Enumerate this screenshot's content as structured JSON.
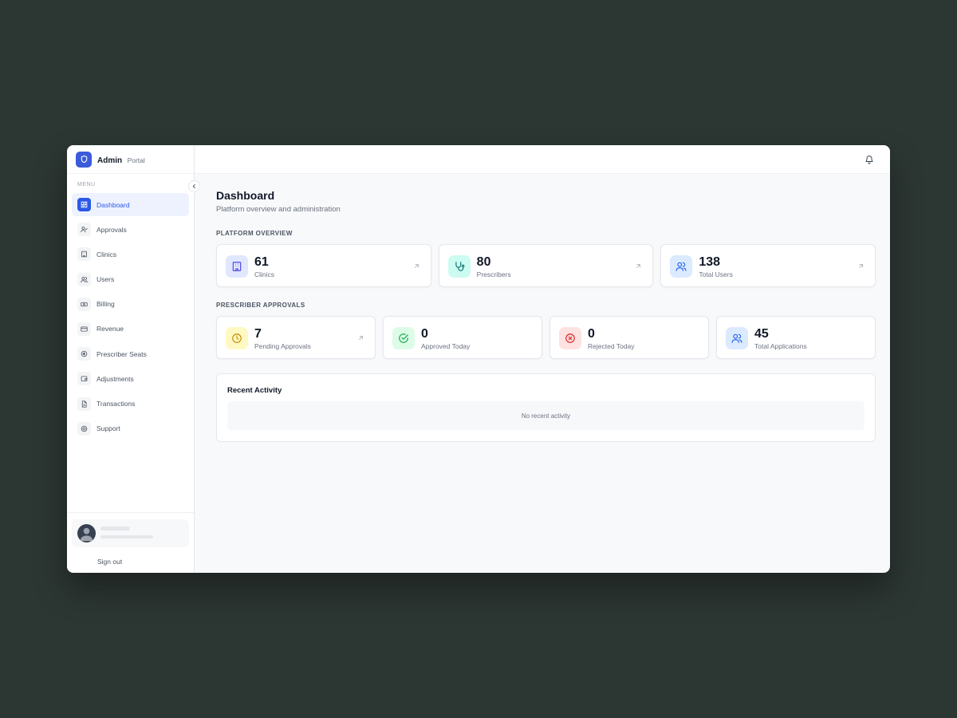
{
  "brand": {
    "title": "Admin",
    "subtitle": "Portal"
  },
  "sidebar": {
    "menu_label": "MENU",
    "items": [
      {
        "label": "Dashboard",
        "icon": "dashboard-icon",
        "active": true
      },
      {
        "label": "Approvals",
        "icon": "user-check-icon"
      },
      {
        "label": "Clinics",
        "icon": "building-icon"
      },
      {
        "label": "Users",
        "icon": "users-icon"
      },
      {
        "label": "Billing",
        "icon": "banknote-icon"
      },
      {
        "label": "Revenue",
        "icon": "credit-card-icon"
      },
      {
        "label": "Prescriber Seats",
        "icon": "currency-icon"
      },
      {
        "label": "Adjustments",
        "icon": "wallet-icon"
      },
      {
        "label": "Transactions",
        "icon": "file-text-icon"
      },
      {
        "label": "Support",
        "icon": "lifebuoy-icon"
      }
    ],
    "sign_out": "Sign out"
  },
  "page": {
    "title": "Dashboard",
    "subtitle": "Platform overview and administration"
  },
  "platform_overview": {
    "label": "PLATFORM OVERVIEW",
    "cards": [
      {
        "value": "61",
        "label": "Clinics",
        "icon": "building-icon",
        "color": "#4f46e5",
        "bg": "#e0e7ff"
      },
      {
        "value": "80",
        "label": "Prescribers",
        "icon": "stethoscope-icon",
        "color": "#0f766e",
        "bg": "#ccfbf1"
      },
      {
        "value": "138",
        "label": "Total Users",
        "icon": "users-icon",
        "color": "#2563eb",
        "bg": "#dbeafe"
      }
    ]
  },
  "prescriber_approvals": {
    "label": "PRESCRIBER APPROVALS",
    "cards": [
      {
        "value": "7",
        "label": "Pending Approvals",
        "icon": "clock-icon",
        "color": "#ca8a04",
        "bg": "#fef9c3"
      },
      {
        "value": "0",
        "label": "Approved Today",
        "icon": "check-circle-icon",
        "color": "#16a34a",
        "bg": "#dcfce7"
      },
      {
        "value": "0",
        "label": "Rejected Today",
        "icon": "x-circle-icon",
        "color": "#dc2626",
        "bg": "#fee2e2"
      },
      {
        "value": "45",
        "label": "Total Applications",
        "icon": "users-icon",
        "color": "#2563eb",
        "bg": "#dbeafe"
      }
    ]
  },
  "recent_activity": {
    "title": "Recent Activity",
    "empty": "No recent activity"
  }
}
